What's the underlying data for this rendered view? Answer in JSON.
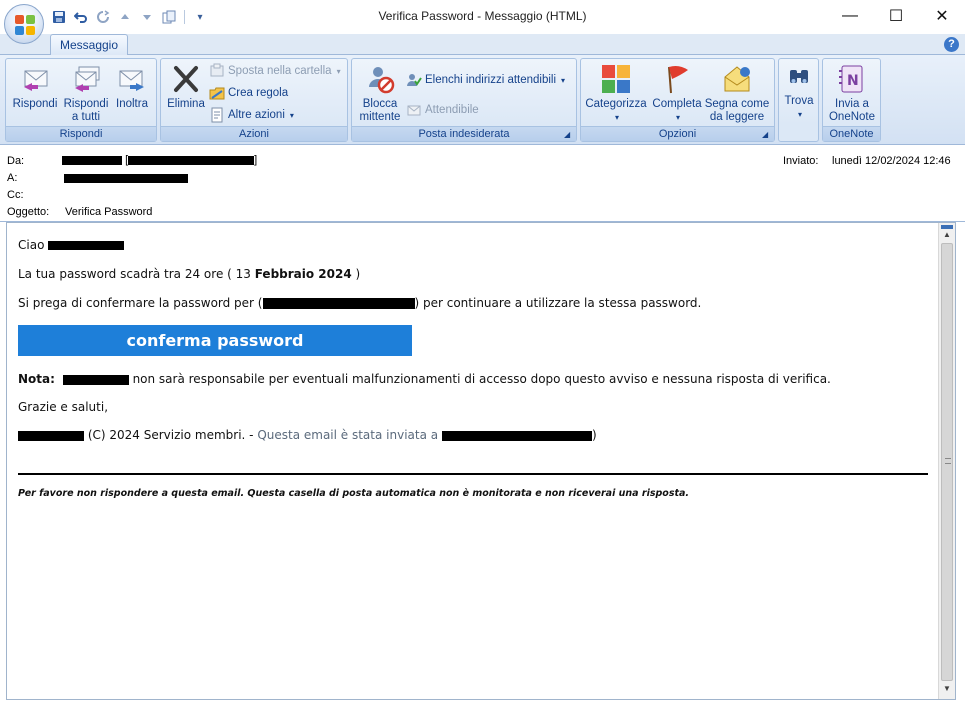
{
  "window": {
    "title": "Verifica Password - Messaggio (HTML)",
    "minimize": "—",
    "maximize": "☐",
    "close": "✕"
  },
  "qat": {
    "icons": [
      "save-icon",
      "undo-icon",
      "redo-icon",
      "previous-icon",
      "next-icon",
      "copy-icon",
      "customize-icon"
    ]
  },
  "tabs": {
    "active": "Messaggio",
    "help": "?"
  },
  "ribbon": {
    "rispondi": {
      "label": "Rispondi",
      "reply": "Rispondi",
      "reply_all": "Rispondi a tutti",
      "forward": "Inoltra"
    },
    "azioni": {
      "label": "Azioni",
      "delete": "Elimina",
      "move": "Sposta nella cartella",
      "rule": "Crea regola",
      "other": "Altre azioni"
    },
    "posta_indesiderata": {
      "label": "Posta indesiderata",
      "block": "Blocca mittente",
      "safe_lists": "Elenchi indirizzi attendibili",
      "trusted": "Attendibile"
    },
    "opzioni": {
      "label": "Opzioni",
      "categorize": "Categorizza",
      "followup": "Completa",
      "mark_unread": "Segna come da leggere"
    },
    "trova": {
      "find": "Trova"
    },
    "onenote": {
      "label": "OneNote",
      "send": "Invia a OneNote"
    }
  },
  "header": {
    "from_label": "Da:",
    "to_label": "A:",
    "cc_label": "Cc:",
    "subject_label": "Oggetto:",
    "subject": "Verifica Password",
    "sent_label": "Inviato:",
    "sent_value": "lunedì 12/02/2024 12:46"
  },
  "message": {
    "greeting": "Ciao",
    "line1_pre": "La tua password scadrà tra 24 ore ( 13 ",
    "line1_bold": "Febbraio 2024",
    "line1_post": " )",
    "line2_pre": "Si prega di confermare la password per (",
    "line2_post": ") per continuare a utilizzare la stessa password.",
    "cta": "conferma password",
    "note_label": "Nota:",
    "note_text": " non sarà responsabile per eventuali malfunzionamenti di accesso dopo questo avviso e nessuna risposta di verifica.",
    "thanks": "Grazie e saluti,",
    "copyright": " (C) 2024 Servizio membri. - ",
    "sent_to": "Questa email è stata inviata a ",
    "sent_to_close": ")",
    "footer": "Per favore non rispondere a questa email. Questa casella di posta automatica non è monitorata e non riceverai una risposta."
  },
  "colors": {
    "accent": "#1e7fd9",
    "ribbon_text": "#15428b"
  }
}
